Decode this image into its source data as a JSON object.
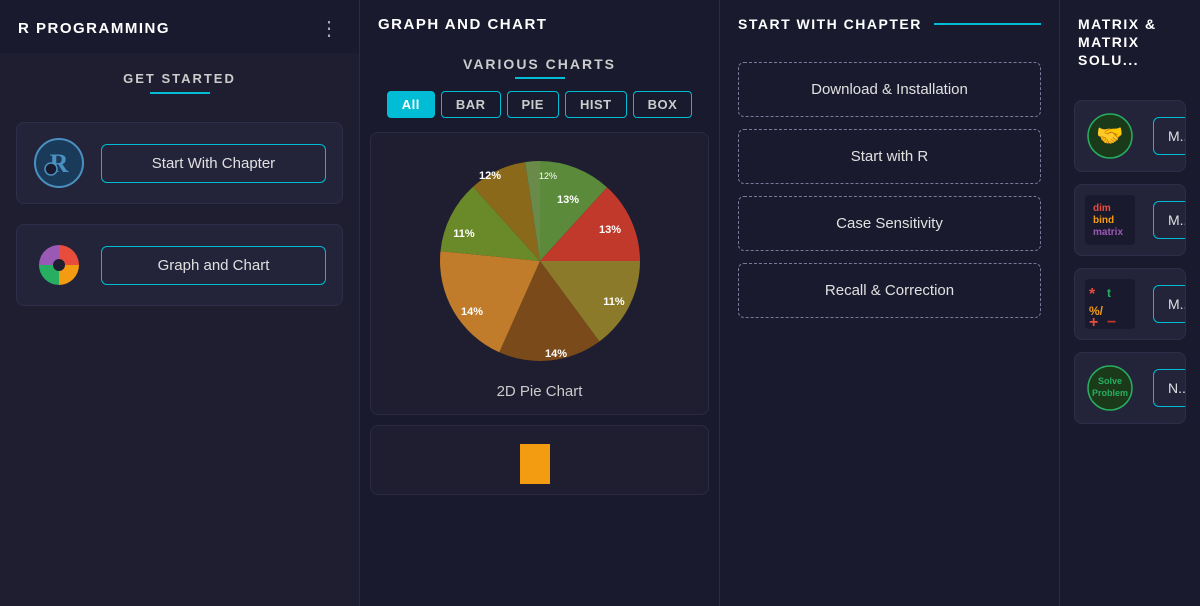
{
  "col1": {
    "title": "R PROGRAMMING",
    "section": "GET STARTED",
    "items": [
      {
        "id": "start-chapter",
        "label": "Start With Chapter"
      },
      {
        "id": "graph-chart",
        "label": "Graph and Chart"
      }
    ]
  },
  "col2": {
    "title": "GRAPH AND CHART",
    "chart_section": "VARIOUS CHARTS",
    "filters": [
      "All",
      "BAR",
      "PIE",
      "HIST",
      "BOX"
    ],
    "active_filter": "All",
    "pie_chart": {
      "caption": "2D Pie Chart",
      "slices": [
        {
          "label": "13%",
          "color": "#5a8a3a",
          "startAngle": 0,
          "endAngle": 46.8
        },
        {
          "label": "13%",
          "color": "#c0392b",
          "startAngle": 46.8,
          "endAngle": 93.6
        },
        {
          "label": "11%",
          "color": "#8b7a2a",
          "startAngle": 93.6,
          "endAngle": 133.2
        },
        {
          "label": "14%",
          "color": "#7a4a1a",
          "startAngle": 133.2,
          "endAngle": 183.6
        },
        {
          "label": "14%",
          "color": "#c07c2a",
          "startAngle": 183.6,
          "endAngle": 234
        },
        {
          "label": "11%",
          "color": "#6a8a2a",
          "startAngle": 234,
          "endAngle": 273.6
        },
        {
          "label": "12%",
          "color": "#8a6a1a",
          "startAngle": 273.6,
          "endAngle": 316.8
        },
        {
          "label": "12%",
          "color": "#6a8a4a",
          "startAngle": 316.8,
          "endAngle": 360
        }
      ]
    }
  },
  "col3": {
    "title": "START WITH CHAPTER",
    "items": [
      {
        "id": "download-install",
        "label": "Download & Installation"
      },
      {
        "id": "start-r",
        "label": "Start with R"
      },
      {
        "id": "case-sensitivity",
        "label": "Case Sensitivity"
      },
      {
        "id": "recall-correction",
        "label": "Recall & Correction"
      }
    ]
  },
  "col4": {
    "title": "MATRIX & MATRIX SOLU...",
    "items": [
      {
        "id": "matrix-1",
        "icon_type": "handshake",
        "btn_text": "M..."
      },
      {
        "id": "matrix-2",
        "icon_type": "dim-bind",
        "btn_text": "M..."
      },
      {
        "id": "matrix-3",
        "icon_type": "operators",
        "btn_text": "M..."
      },
      {
        "id": "matrix-4",
        "icon_type": "solve",
        "btn_text": "N..."
      }
    ]
  }
}
